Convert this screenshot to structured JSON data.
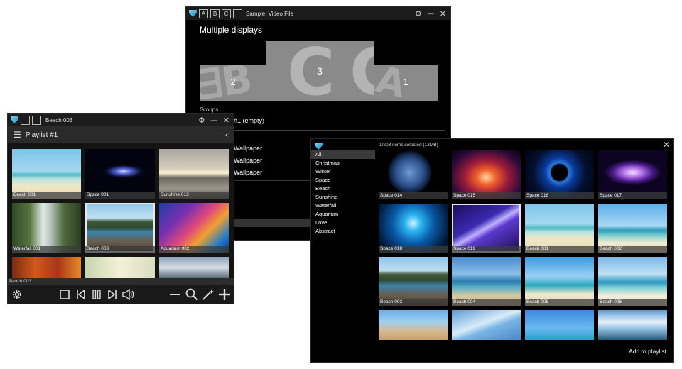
{
  "monitor_window": {
    "title": "Sample: Video File",
    "tab_buttons": [
      "A",
      "B",
      "C"
    ],
    "heading": "Multiple displays",
    "displays": [
      "2",
      "3",
      "1"
    ],
    "groups_label": "Groups",
    "group_value": "#1 (empty)",
    "wallpaper_items": [
      "Wallpaper",
      "Wallpaper",
      "Wallpaper"
    ]
  },
  "player_window": {
    "title": "Beach 003",
    "playlist_title": "Playlist #1",
    "status_text": "Beach 003",
    "thumbs": [
      "Beach 001",
      "Space 001",
      "Sunshine 013",
      "Waterfall 001",
      "Beach 003",
      "Aquarium 002",
      "",
      "",
      ""
    ],
    "selected_thumb": "Beach 003",
    "icons": {
      "settings": "gear-icon",
      "stop": "stop-icon",
      "prev": "skip-back-icon",
      "pause": "pause-icon",
      "next": "skip-forward-icon",
      "volume": "volume-icon",
      "remove": "minus-icon",
      "search": "search-icon",
      "magic": "magic-wand-icon",
      "add": "plus-icon"
    }
  },
  "library_window": {
    "selection_info": "1/203 items selected (13MB)",
    "categories": [
      "All",
      "Christmas",
      "Winter",
      "Space",
      "Beach",
      "Sunshine",
      "Waterfall",
      "Aquarium",
      "Love",
      "Abstract"
    ],
    "active_category": "All",
    "thumbs": [
      "Space 014",
      "Space 015",
      "Space 016",
      "Space 017",
      "Space 018",
      "Space 019",
      "Beach 001",
      "Beach 002",
      "Beach 003",
      "Beach 004",
      "Beach 005",
      "Beach 006",
      "",
      "",
      "",
      ""
    ],
    "selected_thumb": "Space 019",
    "add_button": "Add to playlist"
  }
}
